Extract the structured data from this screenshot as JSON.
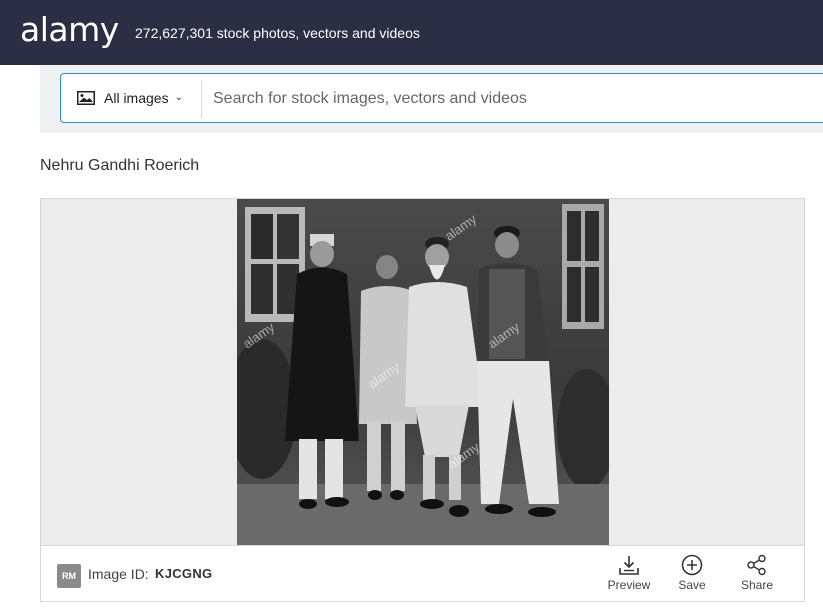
{
  "header": {
    "logo": "alamy",
    "stock_count": "272,627,301 stock photos, vectors and videos"
  },
  "search": {
    "filter_label": "All images",
    "placeholder": "Search for stock images, vectors and videos",
    "value": ""
  },
  "image": {
    "title": "Nehru Gandhi Roerich",
    "watermark": "alamy",
    "rm_badge": "RM",
    "id_label": "Image ID:",
    "id_value": "KJCGNG"
  },
  "actions": {
    "preview": "Preview",
    "save": "Save",
    "share": "Share"
  },
  "colors": {
    "header_bg": "#2c2f44",
    "search_border": "#2a8fbd",
    "panel_bg": "#ececec"
  }
}
